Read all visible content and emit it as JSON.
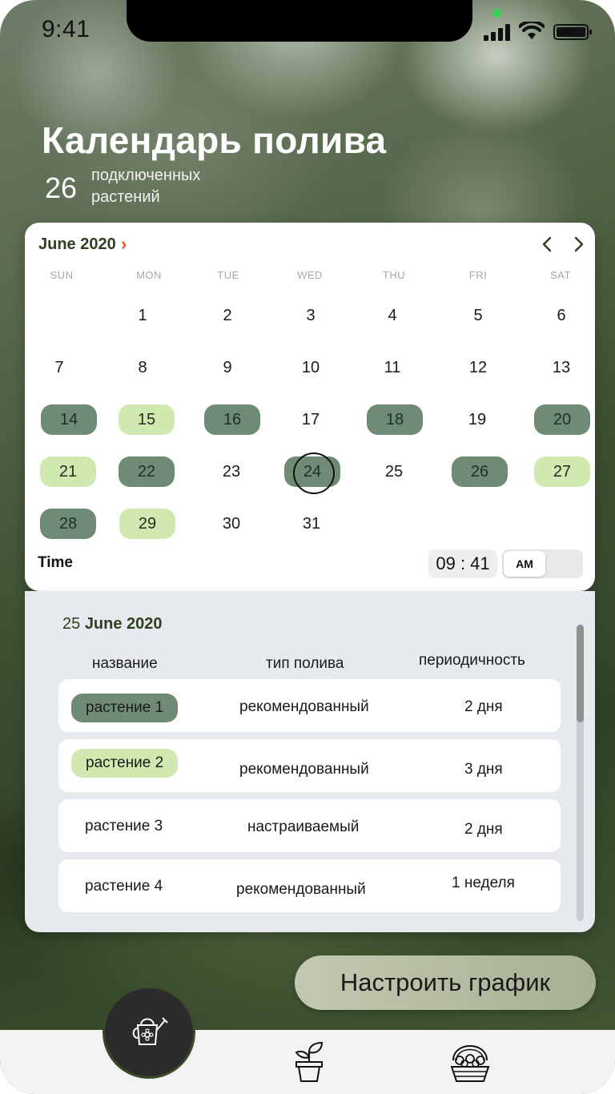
{
  "status": {
    "time": "9:41"
  },
  "header": {
    "title": "Календарь полива",
    "count": "26",
    "count_label": "подключенных растений"
  },
  "calendar": {
    "month": "June 2020",
    "weekdays": [
      "SUN",
      "MON",
      "TUE",
      "WED",
      "THU",
      "FRI",
      "SAT"
    ],
    "days": [
      "1",
      "2",
      "3",
      "4",
      "5",
      "6",
      "7",
      "8",
      "9",
      "10",
      "11",
      "12",
      "13",
      "14",
      "15",
      "16",
      "17",
      "18",
      "19",
      "20",
      "21",
      "22",
      "23",
      "24",
      "25",
      "26",
      "27",
      "28",
      "29",
      "30",
      "31"
    ],
    "time_label": "Time",
    "time_value": "09 : 41",
    "ampm": "AM"
  },
  "schedule": {
    "date_day": "25",
    "date_month": "June 2020",
    "columns": [
      "название",
      "тип полива",
      "периодичность"
    ],
    "rows": [
      {
        "name": "растение 1",
        "type": "рекомендованный",
        "period": "2 дня"
      },
      {
        "name": "растение 2",
        "type": "рекомендованный",
        "period": "3 дня"
      },
      {
        "name": "растение 3",
        "type": "настраиваемый",
        "period": "2 дня"
      },
      {
        "name": "растение 4",
        "type": "рекомендованный",
        "period": "1 неделя"
      }
    ]
  },
  "configure_button": "Настроить график",
  "nav": {
    "items": [
      "watering-can-icon",
      "plant-pot-icon",
      "flower-basket-icon"
    ]
  },
  "colors": {
    "dark_marker": "#6f8b76",
    "light_marker": "#cfe9b1",
    "accent_arrow": "#e8552b"
  }
}
